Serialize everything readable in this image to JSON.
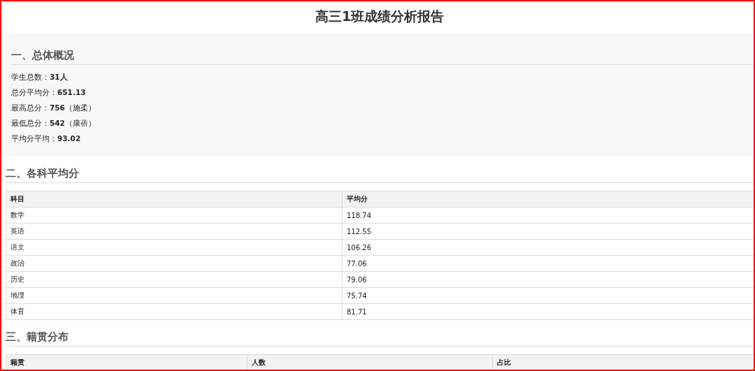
{
  "title": "高三1班成绩分析报告",
  "overview": {
    "heading": "一、总体概况",
    "items": [
      "学生总数：**31人**",
      "总分平均分：**651.13**",
      "最高总分：**756**（施柔）",
      "最低总分：**542**（康蓓）",
      "平均分平均：**93.02**"
    ]
  },
  "subject_averages": {
    "heading": "二、各科平均分",
    "columns": [
      "科目",
      "平均分"
    ],
    "rows": [
      [
        "数学",
        "118.74"
      ],
      [
        "英语",
        "112.55"
      ],
      [
        "语文",
        "106.26"
      ],
      [
        "政治",
        "77.06"
      ],
      [
        "历史",
        "79.06"
      ],
      [
        "地理",
        "75.74"
      ],
      [
        "体育",
        "81.71"
      ]
    ]
  },
  "origin_distribution": {
    "heading": "三、籍贯分布",
    "columns": [
      "籍贯",
      "人数",
      "占比"
    ]
  }
}
